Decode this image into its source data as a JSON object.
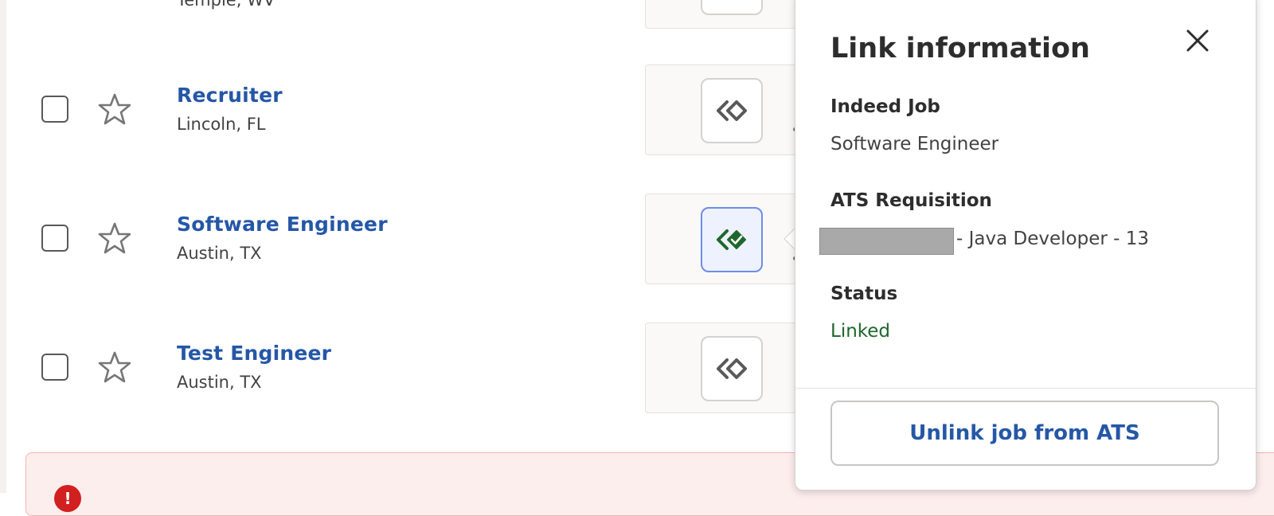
{
  "jobs": [
    {
      "title": "",
      "location": "Temple, WV",
      "linked": false
    },
    {
      "title": "Recruiter",
      "location": "Lincoln, FL",
      "linked": false
    },
    {
      "title": "Software Engineer",
      "location": "Austin, TX",
      "linked": true
    },
    {
      "title": "Test Engineer",
      "location": "Austin, TX",
      "linked": false
    }
  ],
  "panel": {
    "title": "Link information",
    "indeed_job_label": "Indeed Job",
    "indeed_job_value": "Software Engineer",
    "ats_req_label": "ATS Requisition",
    "ats_req_value": "- Java Developer - 13",
    "status_label": "Status",
    "status_value": "Linked",
    "unlink_label": "Unlink job from ATS"
  },
  "alert": {
    "icon": "!"
  },
  "colors": {
    "link_blue": "#2557a7",
    "linked_green": "#1f662c",
    "alert_red": "#d21f1f"
  },
  "icons": {
    "star": "star-outline-icon",
    "link": "link-diamond-icon",
    "linked": "linked-check-icon",
    "close": "close-icon",
    "alert": "alert-circle-icon"
  }
}
